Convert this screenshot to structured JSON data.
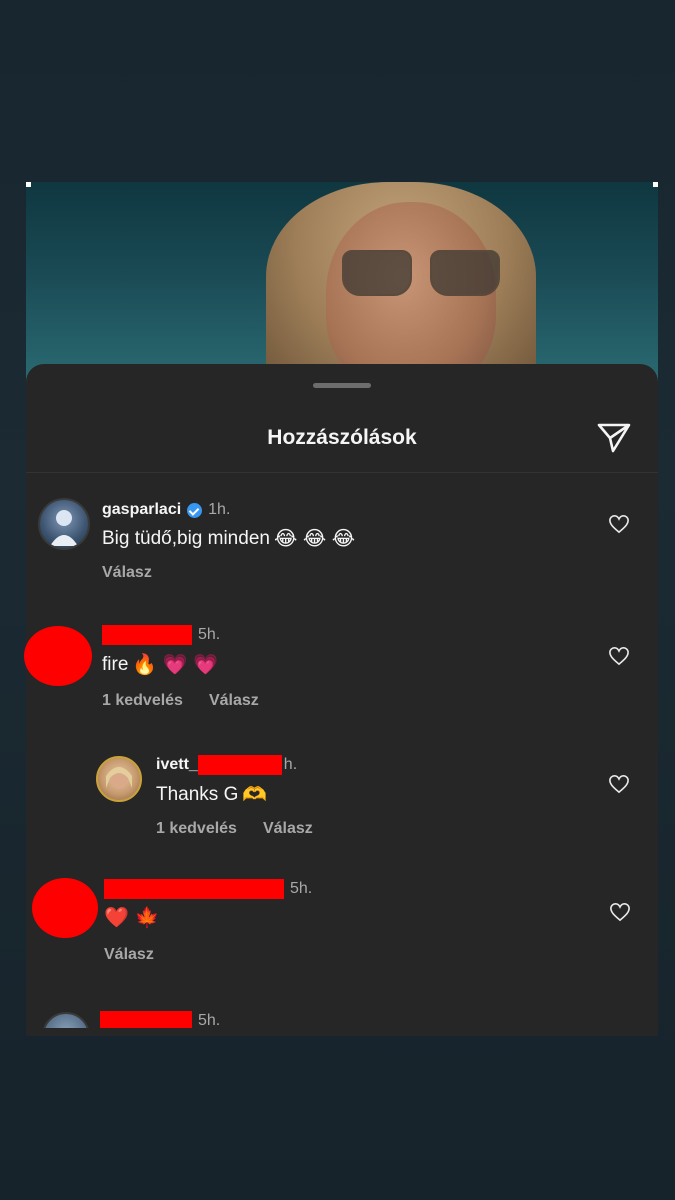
{
  "sheet": {
    "title": "Hozzászólások"
  },
  "comments": [
    {
      "username": "gasparlaci",
      "time": "1h.",
      "text": "Big tüdő,big minden",
      "emojis": "😂 😂 😂",
      "reply_label": "Válasz"
    },
    {
      "time": "5h.",
      "text": "fire",
      "emojis": "🔥 💗 💗",
      "likes": "1 kedvelés",
      "reply_label": "Válasz"
    },
    {
      "username": "ivett_",
      "time": "h.",
      "text": "Thanks G",
      "emojis": "🫶",
      "likes": "1 kedvelés",
      "reply_label": "Válasz"
    },
    {
      "time": "5h.",
      "emojis": "❤️ 🍁",
      "reply_label": "Válasz"
    },
    {
      "time": "5h."
    }
  ],
  "colors": {
    "sheet_bg": "#262626",
    "redaction": "#ff0000",
    "verified": "#3897f0",
    "secondary_text": "#a8a8a8"
  },
  "icons": [
    "send-icon",
    "heart-outline-icon",
    "verified-badge-icon"
  ]
}
